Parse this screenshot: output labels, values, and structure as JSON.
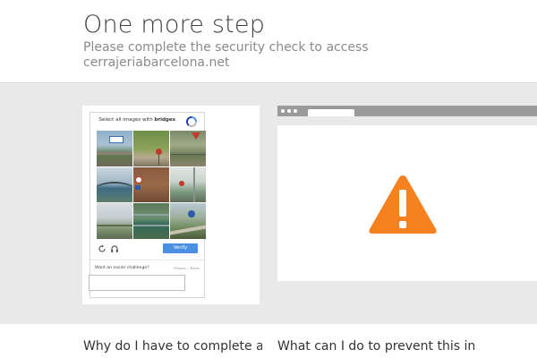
{
  "header": {
    "title": "One more step",
    "subtitle": "Please complete the security check to access cerrajeriabarcelona.net"
  },
  "captcha": {
    "prompt_prefix": "Select all images with ",
    "prompt_keyword": "bridges",
    "prompt_suffix": ".",
    "tiles": [
      "tile-1",
      "tile-2",
      "tile-3",
      "tile-4",
      "tile-5",
      "tile-6",
      "tile-7",
      "tile-8",
      "tile-9"
    ],
    "reload_icon": "reload-icon",
    "audio_icon": "headphones-icon",
    "verify_label": "Verify",
    "easier_link": "Want an easier challenge?",
    "privacy_label": "Privacy",
    "separator": " - ",
    "terms_label": "Terms",
    "response_value": "",
    "accent_color": "#4a90e2"
  },
  "browser_illustration": {
    "warning_icon": "warning-icon",
    "warning_color": "#f6821f"
  },
  "faq": {
    "q1": "Why do I have to complete a CAPTCHA?",
    "q2": "What can I do to prevent this in the future?"
  }
}
